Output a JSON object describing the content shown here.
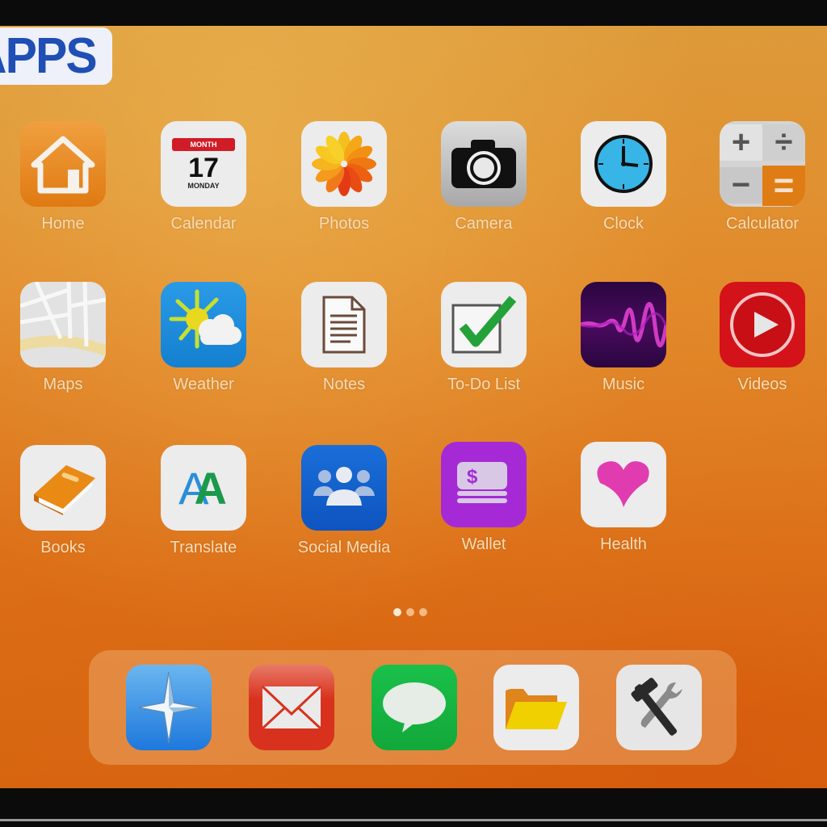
{
  "badge": {
    "text": "APPS",
    "color": "#1f4fb5"
  },
  "apps": [
    {
      "label": "Home",
      "icon": "home-icon",
      "bg": "#e8871f"
    },
    {
      "label": "Calendar",
      "icon": "calendar-icon",
      "bg": "#ececec",
      "calendar": {
        "month": "MONTH",
        "day": "17",
        "weekday": "MONDAY"
      }
    },
    {
      "label": "Photos",
      "icon": "photos-flower-icon",
      "bg": "#ececec"
    },
    {
      "label": "Camera",
      "icon": "camera-icon",
      "bg": "#c9c9c9"
    },
    {
      "label": "Clock",
      "icon": "clock-icon",
      "bg": "#ececec"
    },
    {
      "label": "Calculator",
      "icon": "calculator-icon",
      "bg": "#d9d9d9",
      "calculator": {
        "plus": "+",
        "divide": "÷",
        "minus": "−",
        "equals": "="
      }
    },
    {
      "label": "Maps",
      "icon": "map-icon",
      "bg": "#e6e6e6"
    },
    {
      "label": "Weather",
      "icon": "weather-sun-cloud-icon",
      "bg": "#1a8ee0"
    },
    {
      "label": "Notes",
      "icon": "notes-document-icon",
      "bg": "#ececec"
    },
    {
      "label": "To-Do List",
      "icon": "checkbox-check-icon",
      "bg": "#ececec"
    },
    {
      "label": "Music",
      "icon": "sound-wave-icon",
      "bg": "#3a0a4a"
    },
    {
      "label": "Videos",
      "icon": "play-circle-icon",
      "bg": "#d4121a"
    },
    {
      "label": "Books",
      "icon": "book-icon",
      "bg": "#ececec"
    },
    {
      "label": "Translate",
      "icon": "translate-aa-icon",
      "bg": "#ececec",
      "translate": {
        "a1": "A",
        "a2": "A"
      }
    },
    {
      "label": "Social Media",
      "icon": "people-group-icon",
      "bg": "#1560d0"
    },
    {
      "label": "Wallet",
      "icon": "wallet-money-icon",
      "bg": "#a52ad6",
      "wallet": {
        "symbol": "$"
      }
    },
    {
      "label": "Health",
      "icon": "heart-icon",
      "bg": "#ececec"
    }
  ],
  "page_indicator": {
    "pages": 3,
    "current": 1
  },
  "dock": [
    {
      "name": "compass",
      "icon": "compass-star-icon",
      "bg": "#2f86e0"
    },
    {
      "name": "mail",
      "icon": "mail-envelope-icon",
      "bg": "#e0442c"
    },
    {
      "name": "messages",
      "icon": "speech-bubble-icon",
      "bg": "#18b843"
    },
    {
      "name": "files",
      "icon": "folder-icon",
      "bg": "#ececec"
    },
    {
      "name": "settings",
      "icon": "tools-hammer-wrench-icon",
      "bg": "#e6e6e6"
    }
  ]
}
